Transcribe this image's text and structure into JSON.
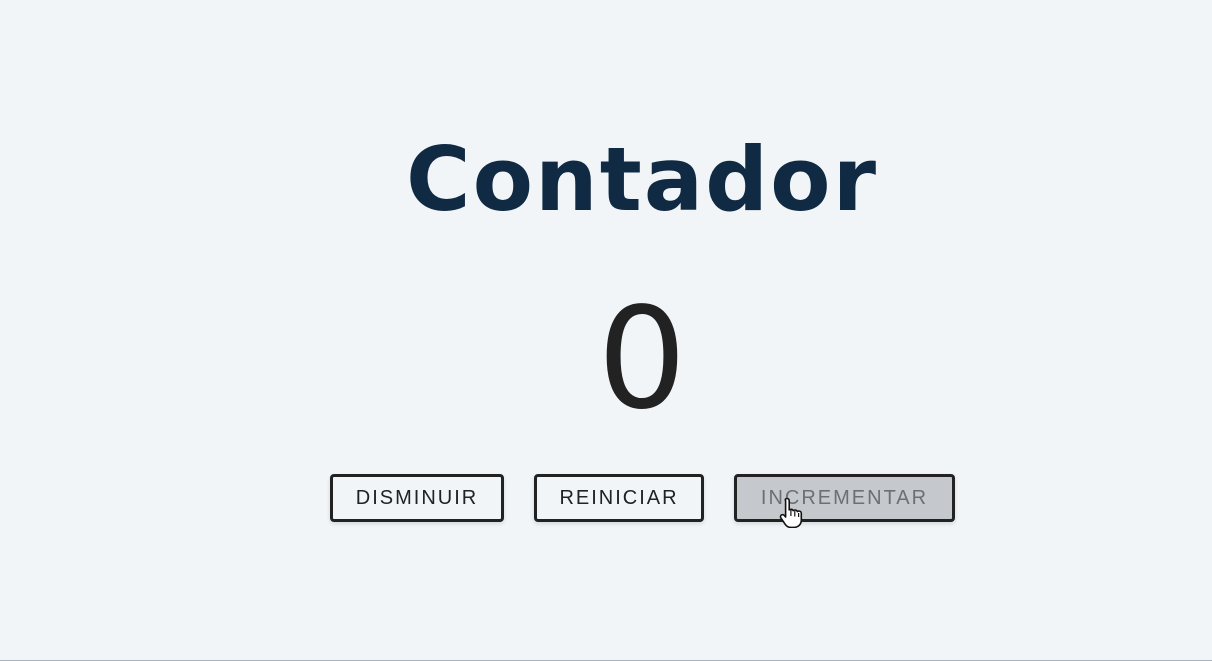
{
  "title": "Contador",
  "count": "0",
  "buttons": {
    "decrease_label": "DISMINUIR",
    "reset_label": "REINICIAR",
    "increase_label": "INCREMENTAR"
  },
  "colors": {
    "background": "#f1f5f8",
    "title": "#102a43",
    "count": "#222222",
    "button_border": "#222222",
    "button_hover_background": "#c5c9cd"
  },
  "cursor": "hand-pointer-icon"
}
